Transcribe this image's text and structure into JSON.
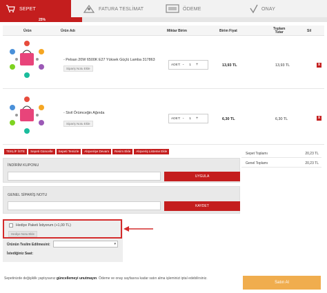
{
  "steps": [
    {
      "label": "SEPET",
      "icon": "cart-icon"
    },
    {
      "label": "FATURA TESLİMAT",
      "icon": "delivery-icon"
    },
    {
      "label": "ÖDEME",
      "icon": "payment-icon"
    },
    {
      "label": "ONAY",
      "icon": "check-icon"
    }
  ],
  "progress": {
    "percent_label": "25%",
    "fraction": 0.25
  },
  "table": {
    "headers": {
      "product": "Ürün",
      "product_name": "Ürün Adı",
      "qty": "Miktar Birim",
      "unit_price": "Birim Fiyat",
      "total_line1": "Toplam",
      "total_line2": "Tutar",
      "delete": "Sil"
    }
  },
  "items": [
    {
      "name": "- Pelsan 20W 6500K E27 Yüksek Güçlü Lamba 317863",
      "gift_note": "Sipariş Notu Ekle",
      "qty_label": "ADET:",
      "qty": "1",
      "minus": "-",
      "plus": "+",
      "unit_price": "13,93 TL",
      "total": "13,93 TL",
      "delete": "x"
    },
    {
      "name": "- Sivil Örümceğin Ağında",
      "gift_note": "Sipariş Notu Ekle",
      "qty_label": "ADET:",
      "qty": "1",
      "minus": "-",
      "plus": "+",
      "unit_price": "6,30 TL",
      "total": "6,30 TL",
      "delete": "x"
    }
  ],
  "actions": [
    "TEKLİF İSTE",
    "Sepeti Güncelle",
    "Sepeti Temizle",
    "Alışverişe Devam",
    "Resim Ekle",
    "Alışveriş Listeme Ekle"
  ],
  "summary": {
    "subtotal_label": "Sepet Toplamı",
    "subtotal_value": "20,23 TL",
    "grand_label": "Genel Toplamı",
    "grand_value": "20,23 TL"
  },
  "coupon": {
    "title": "İNDİRİM KUPONU",
    "placeholder": "",
    "button": "UYGULA"
  },
  "order_note": {
    "title": "GENEL SİPARİŞ NOTU",
    "placeholder": "",
    "button": "KAYDET"
  },
  "gift": {
    "label": "Hediye Paketi İstiyorum (+1,00 TL)",
    "note": "Hediye Notu Ekle"
  },
  "delivery": {
    "date_label": "Ürünün Teslim Edilmesini:",
    "time_label": "İstediğiniz Saat:"
  },
  "footer": {
    "note_start": "Sepetinizde değişiklik yaptıysanız ",
    "note_bold": "güncellemeyi unutmayın",
    "note_end": ". Ödeme ve onay sayfasına kadar satın alma işleminizi iptal edebilirsiniz."
  },
  "pay_button": "Satın Al",
  "colors": {
    "accent": "#c41e1e",
    "pay": "#f0ad4e"
  }
}
